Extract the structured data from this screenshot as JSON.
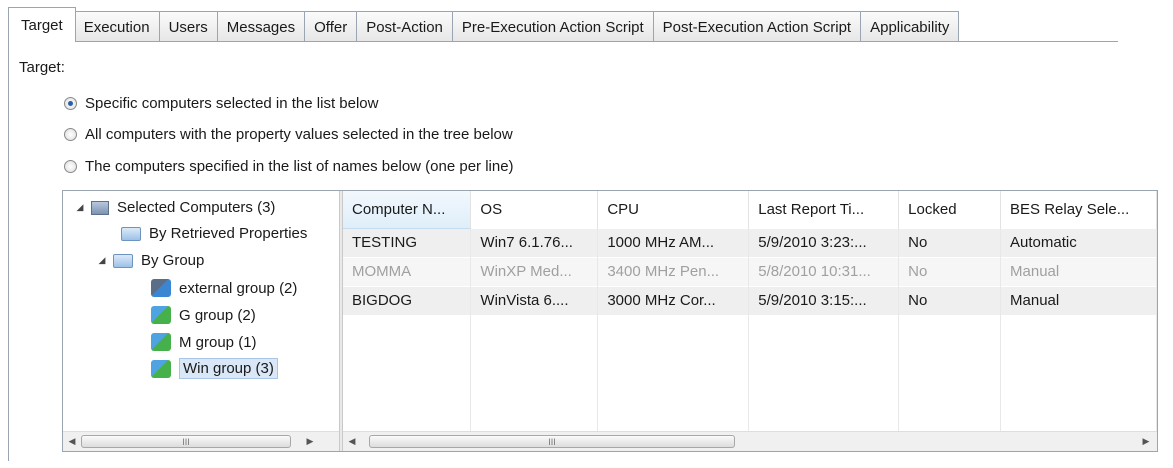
{
  "tabs": [
    {
      "label": "Target",
      "active": true
    },
    {
      "label": "Execution",
      "active": false
    },
    {
      "label": "Users",
      "active": false
    },
    {
      "label": "Messages",
      "active": false
    },
    {
      "label": "Offer",
      "active": false
    },
    {
      "label": "Post-Action",
      "active": false
    },
    {
      "label": "Pre-Execution Action Script",
      "active": false
    },
    {
      "label": "Post-Execution Action Script",
      "active": false
    },
    {
      "label": "Applicability",
      "active": false
    }
  ],
  "target": {
    "label": "Target:",
    "options": [
      {
        "label": "Specific computers selected in the list below",
        "checked": true
      },
      {
        "label": "All computers with the property values selected in the tree below",
        "checked": false
      },
      {
        "label": "The computers specified in the list of names below (one per line)",
        "checked": false
      }
    ]
  },
  "tree": {
    "root": "Selected Computers (3)",
    "retrieved": "By Retrieved Properties",
    "by_group": "By Group",
    "groups": [
      "external group (2)",
      "G group (2)",
      "M group (1)",
      "Win group (3)"
    ],
    "selected": "Win group (3)"
  },
  "table": {
    "columns": [
      "Computer N...",
      "OS",
      "CPU",
      "Last Report Ti...",
      "Locked",
      "BES Relay Sele..."
    ],
    "rows": [
      {
        "cells": [
          "TESTING",
          "Win7 6.1.76...",
          "1000 MHz AM...",
          "5/9/2010 3:23:...",
          "No",
          "Automatic"
        ],
        "dim": false
      },
      {
        "cells": [
          "MOMMA",
          "WinXP Med...",
          "3400 MHz Pen...",
          "5/8/2010 10:31...",
          "No",
          "Manual"
        ],
        "dim": true
      },
      {
        "cells": [
          "BIGDOG",
          "WinVista 6....",
          "3000 MHz Cor...",
          "5/9/2010 3:15:...",
          "No",
          "Manual"
        ],
        "dim": false
      }
    ]
  },
  "scroll": {
    "thumb_grip": "III"
  }
}
